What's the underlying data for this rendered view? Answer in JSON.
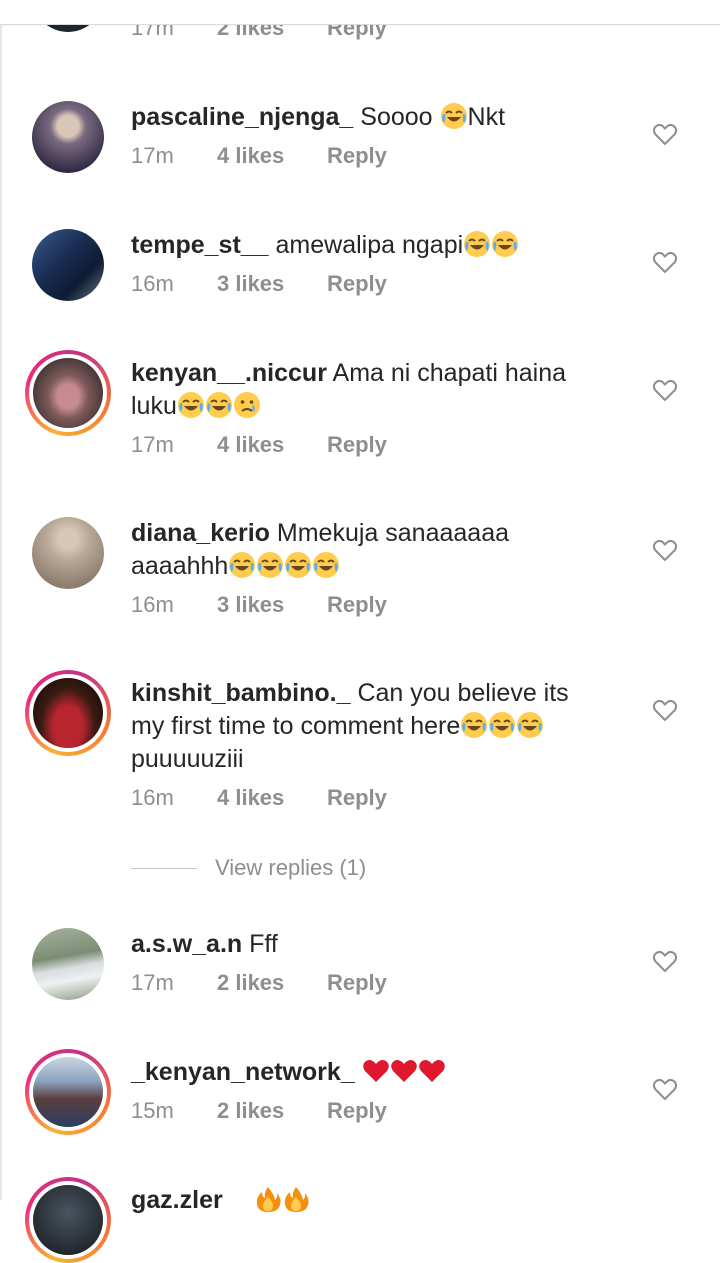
{
  "top_partial": {
    "time": "17m",
    "likes": "2 likes",
    "reply": "Reply"
  },
  "comments": [
    {
      "username": "pascaline_njenga_",
      "text": "Soooo",
      "text2": "Nkt",
      "time": "17m",
      "likes": "4 likes",
      "reply": "Reply"
    },
    {
      "username": "tempe_st__",
      "text": "amewalipa ngapi",
      "time": "16m",
      "likes": "3 likes",
      "reply": "Reply"
    },
    {
      "username": "kenyan__.niccur",
      "text": "Ama ni chapati haina",
      "text2": "luku",
      "time": "17m",
      "likes": "4 likes",
      "reply": "Reply"
    },
    {
      "username": "diana_kerio",
      "text": "Mmekuja sanaaaaaa",
      "text2": "aaaahhh",
      "time": "16m",
      "likes": "3 likes",
      "reply": "Reply"
    },
    {
      "username": "kinshit_bambino._",
      "text": "Can you believe its",
      "text2": "my first time to comment here",
      "text3": "puuuuuziii",
      "time": "16m",
      "likes": "4 likes",
      "reply": "Reply",
      "view_replies": "View replies (1)"
    },
    {
      "username": "a.s.w_a.n",
      "text": "Fff",
      "time": "17m",
      "likes": "2 likes",
      "reply": "Reply"
    },
    {
      "username": "_kenyan_network_",
      "text": "",
      "time": "15m",
      "likes": "2 likes",
      "reply": "Reply"
    },
    {
      "username": "gaz.zler"
    }
  ],
  "icons": {
    "like": "heart-outline-icon",
    "laugh": "face-with-tears-of-joy-emoji",
    "cry": "crying-face-emoji",
    "love": "red-heart-emoji",
    "fire": "fire-emoji"
  },
  "colors": {
    "text": "#262626",
    "meta": "#8e8e8e",
    "story_ring": "#ee2a7b",
    "heart_emoji": "#e0182d"
  }
}
